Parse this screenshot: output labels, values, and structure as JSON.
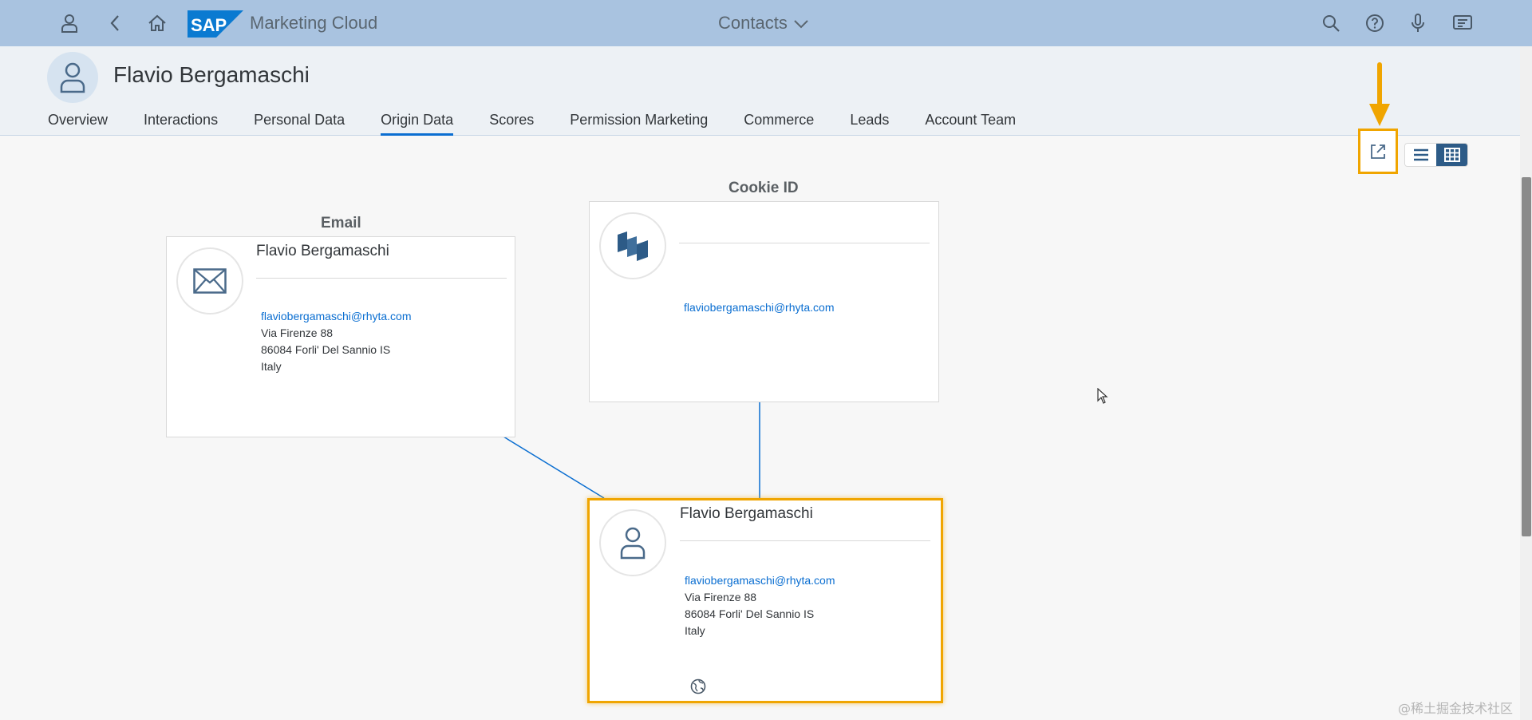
{
  "shell": {
    "app_title": "Marketing Cloud",
    "nav_title": "Contacts",
    "logo_text": "SAP",
    "icons": [
      "user-icon",
      "back-icon",
      "home-icon",
      "search-icon",
      "help-icon",
      "microphone-icon",
      "notifications-icon"
    ]
  },
  "header": {
    "title": "Flavio Bergamaschi",
    "tabs": [
      {
        "label": "Overview"
      },
      {
        "label": "Interactions"
      },
      {
        "label": "Personal Data"
      },
      {
        "label": "Origin Data",
        "active": true
      },
      {
        "label": "Scores"
      },
      {
        "label": "Permission Marketing"
      },
      {
        "label": "Commerce"
      },
      {
        "label": "Leads"
      },
      {
        "label": "Account Team"
      }
    ]
  },
  "graph": {
    "email_node": {
      "label": "Email",
      "name": "Flavio Bergamaschi",
      "email": "flaviobergamaschi@rhyta.com",
      "address1": "Via Firenze 88",
      "address2": "86084 Forli' Del Sannio IS",
      "country": "Italy"
    },
    "cookie_node": {
      "label": "Cookie ID",
      "name": "",
      "email": "flaviobergamaschi@rhyta.com"
    },
    "contact_node": {
      "name": "Flavio Bergamaschi",
      "email": "flaviobergamaschi@rhyta.com",
      "address1": "Via Firenze 88",
      "address2": "86084 Forli' Del Sannio IS",
      "country": "Italy"
    }
  },
  "watermark": "@稀土掘金技术社区",
  "colors": {
    "shell_bg": "#a9c3e0",
    "accent": "#0a6ed1",
    "highlight": "#f0a500",
    "toggle_active": "#2d5b87"
  }
}
